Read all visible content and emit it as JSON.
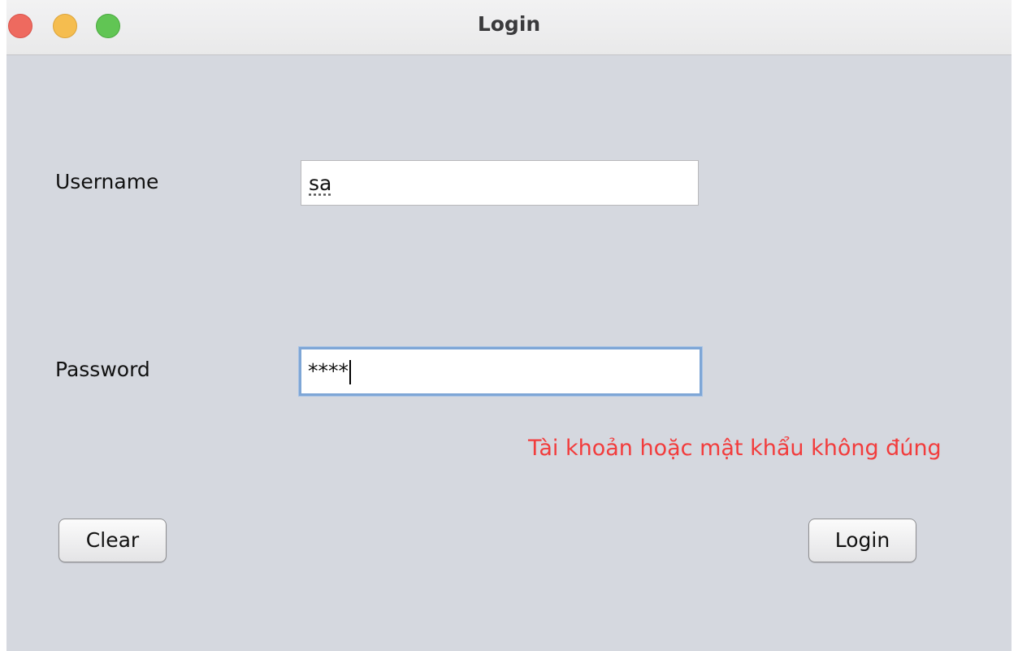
{
  "window": {
    "title": "Login"
  },
  "form": {
    "username_label": "Username",
    "username_value": "sa",
    "password_label": "Password",
    "password_value": "****",
    "error_message": "Tài khoản hoặc mật khẩu không đúng"
  },
  "buttons": {
    "clear_label": "Clear",
    "login_label": "Login"
  },
  "colors": {
    "background": "#d5d8df",
    "error": "#f23c3c",
    "focus_ring": "#7ea6d6"
  }
}
